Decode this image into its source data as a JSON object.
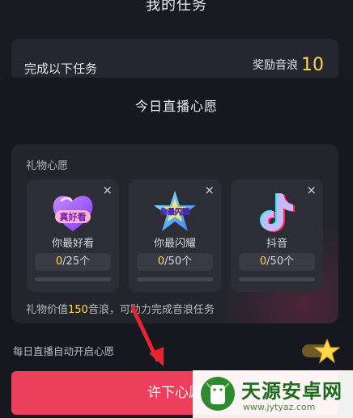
{
  "header": {
    "title": "我的任务"
  },
  "task_card": {
    "left_text": "完成以下任务",
    "reward_label": "奖励音浪",
    "reward_value": "10"
  },
  "sheet": {
    "title": "今日直播心愿"
  },
  "wish_panel": {
    "label": "礼物心愿",
    "gifts": [
      {
        "name": "你最好看",
        "current": "0",
        "target": "/25个",
        "close": "×",
        "art_text": "真好看"
      },
      {
        "name": "你最闪耀",
        "current": "0",
        "target": "/50个",
        "close": "×",
        "art_text": "你最闪耀"
      },
      {
        "name": "抖音",
        "current": "0",
        "target": "/50个",
        "close": "×"
      }
    ],
    "note_prefix": "礼物价值",
    "note_value": "150",
    "note_suffix": "音浪，可助力完成音浪任务"
  },
  "auto_open": {
    "label": "每日直播自动开启心愿",
    "enabled": true
  },
  "cta": {
    "label": "许下心愿"
  },
  "watermark": {
    "name": "天源安卓网",
    "url": "www.jytyaz.com"
  },
  "colors": {
    "accent": "#ec3f5c",
    "highlight": "#ffd84a",
    "background": "#16161d",
    "card": "#24242d"
  }
}
